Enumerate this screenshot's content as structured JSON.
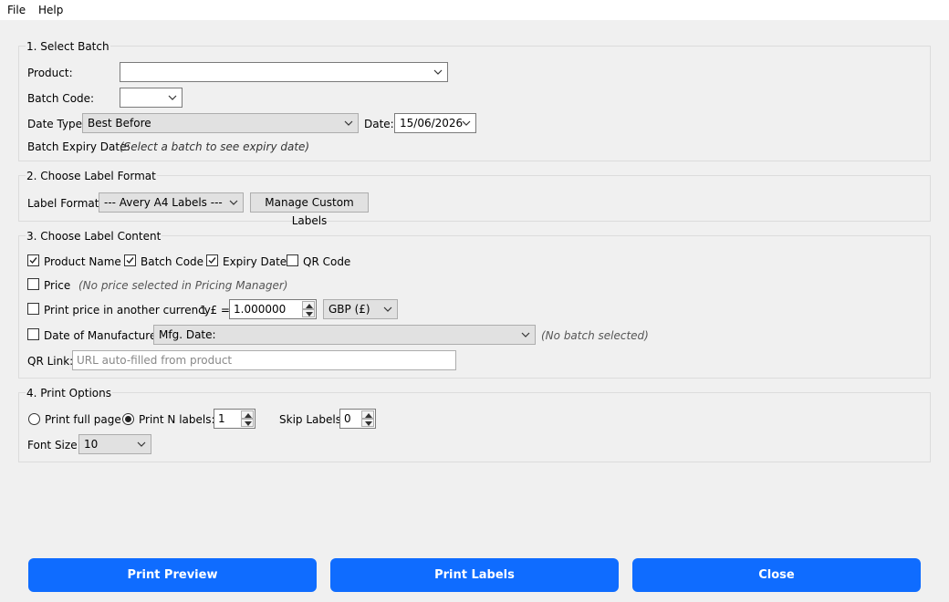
{
  "menu": {
    "file": "File",
    "help": "Help"
  },
  "section1": {
    "title": "1. Select Batch",
    "product_label": "Product:",
    "product_value": "",
    "batch_code_label": "Batch Code:",
    "batch_code_value": "",
    "date_type_label": "Date Type:",
    "date_type_value": "Best Before",
    "date_label": "Date:",
    "date_value": "15/06/2026",
    "expiry_label": "Batch Expiry Date:",
    "expiry_hint": "(Select a batch to see expiry date)"
  },
  "section2": {
    "title": "2. Choose Label Format",
    "format_label": "Label Format:",
    "format_value": "--- Avery A4 Labels ---",
    "manage_button": "Manage Custom Labels"
  },
  "section3": {
    "title": "3. Choose Label Content",
    "product_name": {
      "label": "Product Name",
      "checked": true
    },
    "batch_code": {
      "label": "Batch Code",
      "checked": true
    },
    "expiry_date": {
      "label": "Expiry Date",
      "checked": true
    },
    "qr_code": {
      "label": "QR Code",
      "checked": false
    },
    "price": {
      "label": "Price",
      "checked": false,
      "hint": "(No price selected in Pricing Manager)"
    },
    "currency": {
      "label": "Print price in another currency",
      "checked": false,
      "rate_label": "1 £ =",
      "rate_value": "1.000000",
      "currency_value": "GBP (£)"
    },
    "manufacture": {
      "label": "Date of Manufacture",
      "checked": false,
      "combo_value": "Mfg. Date:",
      "hint": "(No batch selected)"
    },
    "qr_link_label": "QR Link:",
    "qr_link_placeholder": "URL auto-filled from product"
  },
  "section4": {
    "title": "4. Print Options",
    "full_page_label": "Print full page",
    "full_page_selected": false,
    "n_labels_label": "Print N labels:",
    "n_labels_selected": true,
    "n_labels_value": "1",
    "skip_label": "Skip Labels:",
    "skip_value": "0",
    "font_size_label": "Font Size:",
    "font_size_value": "10"
  },
  "buttons": {
    "preview": "Print Preview",
    "print": "Print Labels",
    "close": "Close"
  },
  "colors": {
    "accent": "#0f6cff",
    "background": "#f0f0f0"
  },
  "icons": {
    "dropdown": "chevron-down-icon",
    "check": "check-icon",
    "spin_up": "arrow-up-icon",
    "spin_down": "arrow-down-icon"
  }
}
